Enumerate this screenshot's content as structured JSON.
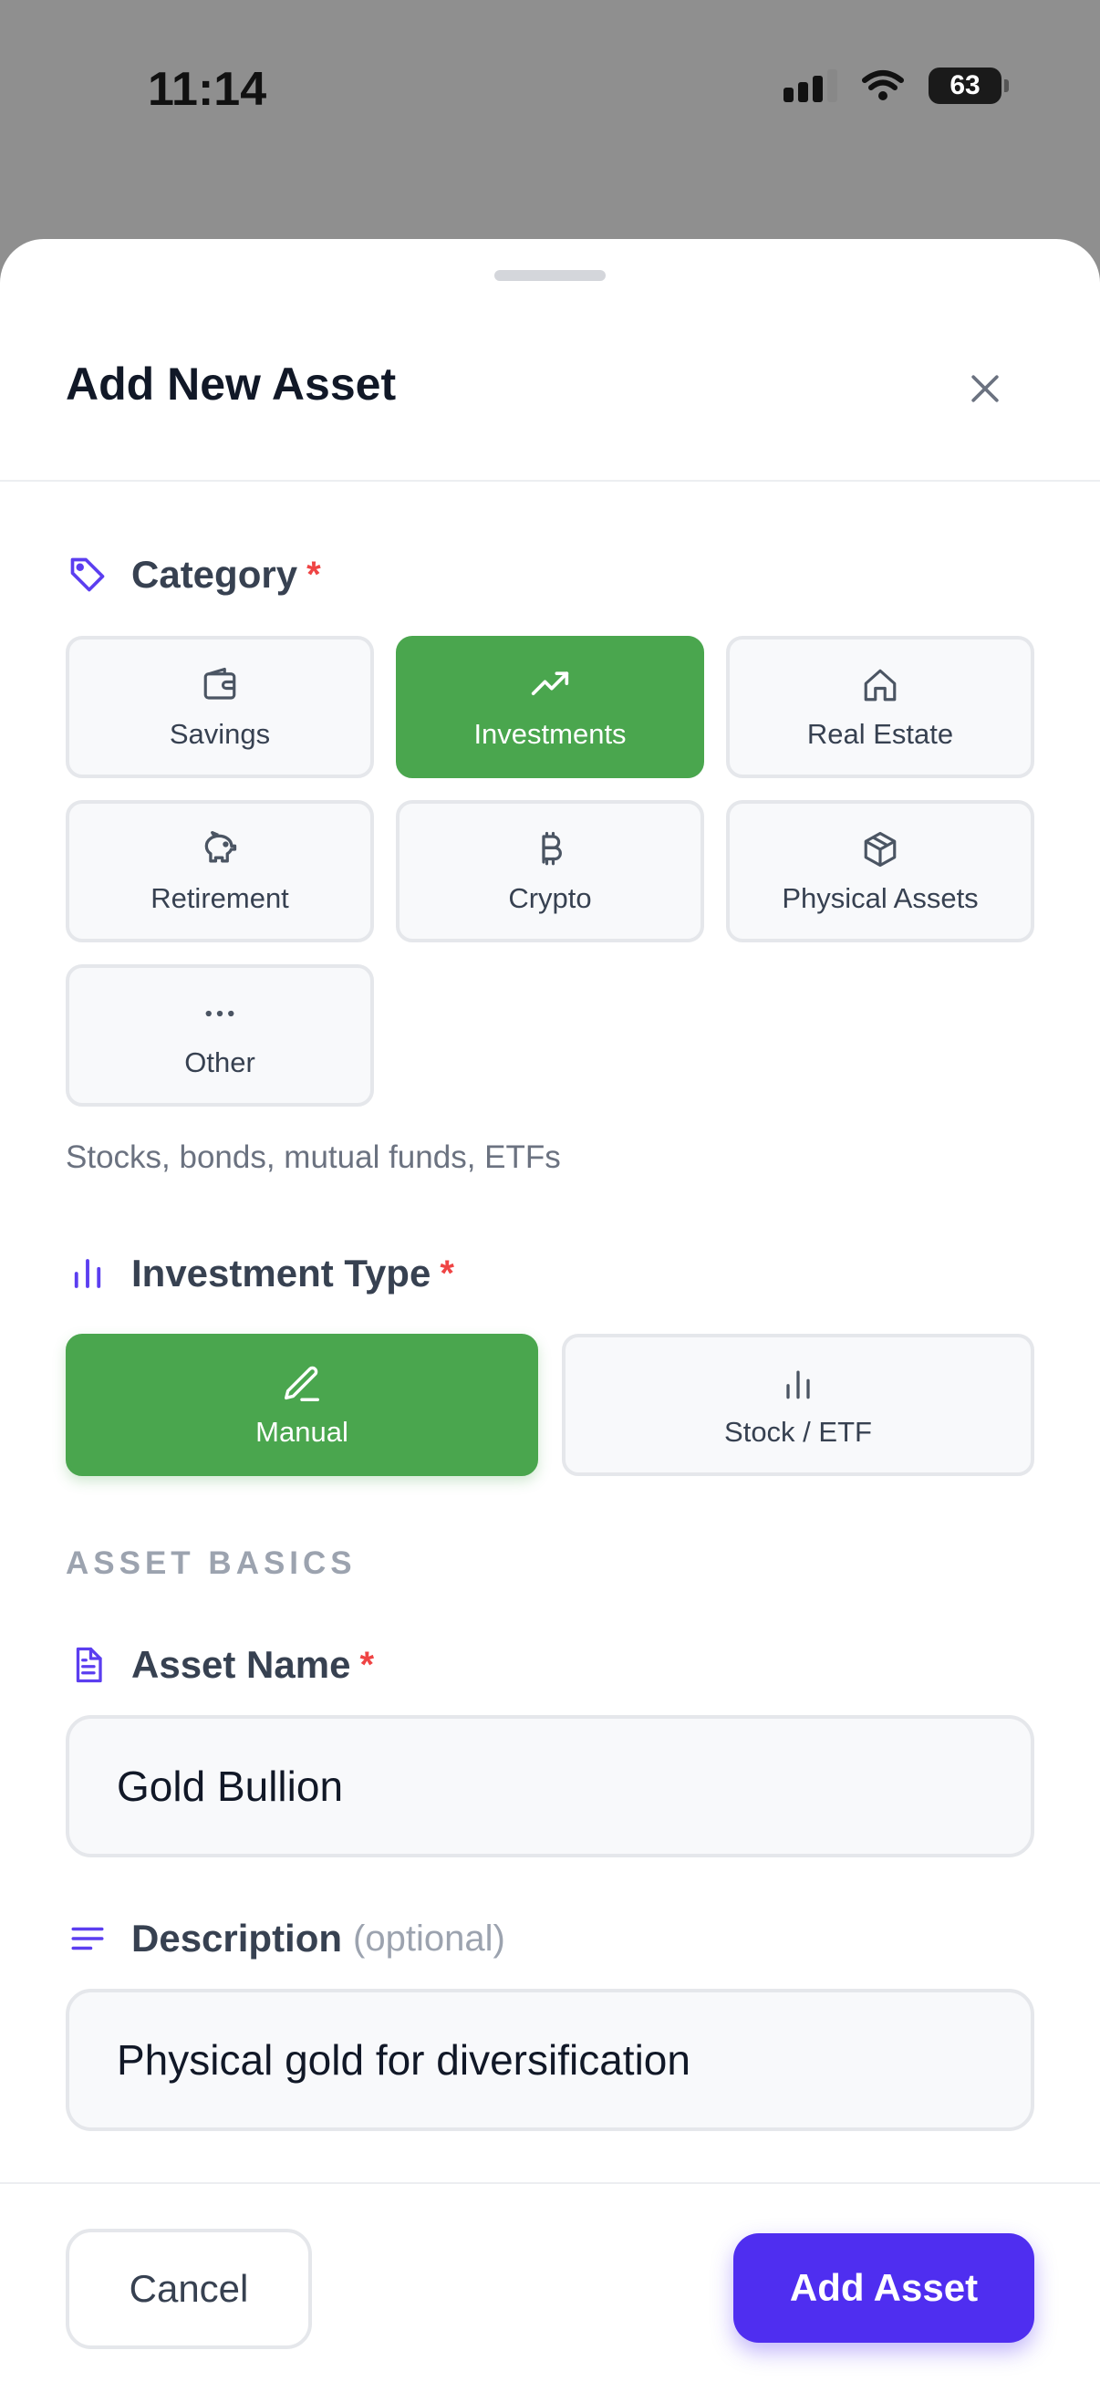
{
  "status_bar": {
    "time": "11:14",
    "battery": "63"
  },
  "sheet": {
    "title": "Add New Asset"
  },
  "category": {
    "label": "Category",
    "required_mark": "*",
    "options": [
      {
        "label": "Savings",
        "icon": "wallet-icon",
        "selected": false
      },
      {
        "label": "Investments",
        "icon": "trending-up-icon",
        "selected": true
      },
      {
        "label": "Real Estate",
        "icon": "home-icon",
        "selected": false
      },
      {
        "label": "Retirement",
        "icon": "piggy-bank-icon",
        "selected": false
      },
      {
        "label": "Crypto",
        "icon": "bitcoin-icon",
        "selected": false
      },
      {
        "label": "Physical Assets",
        "icon": "package-icon",
        "selected": false
      },
      {
        "label": "Other",
        "icon": "more-horizontal-icon",
        "selected": false
      }
    ],
    "hint": "Stocks, bonds, mutual funds, ETFs"
  },
  "investment_type": {
    "label": "Investment Type",
    "required_mark": "*",
    "options": [
      {
        "label": "Manual",
        "icon": "pencil-icon",
        "selected": true
      },
      {
        "label": "Stock / ETF",
        "icon": "bar-chart-icon",
        "selected": false
      }
    ]
  },
  "asset_basics": {
    "section_title": "ASSET BASICS",
    "name": {
      "label": "Asset Name",
      "required_mark": "*",
      "value": "Gold Bullion"
    },
    "description": {
      "label": "Description",
      "optional_text": "(optional)",
      "value": "Physical gold for diversification"
    }
  },
  "footer": {
    "cancel_label": "Cancel",
    "submit_label": "Add Asset"
  },
  "colors": {
    "accent": "#4f2ef0",
    "selected": "#4aa64e",
    "required": "#ef4444"
  }
}
